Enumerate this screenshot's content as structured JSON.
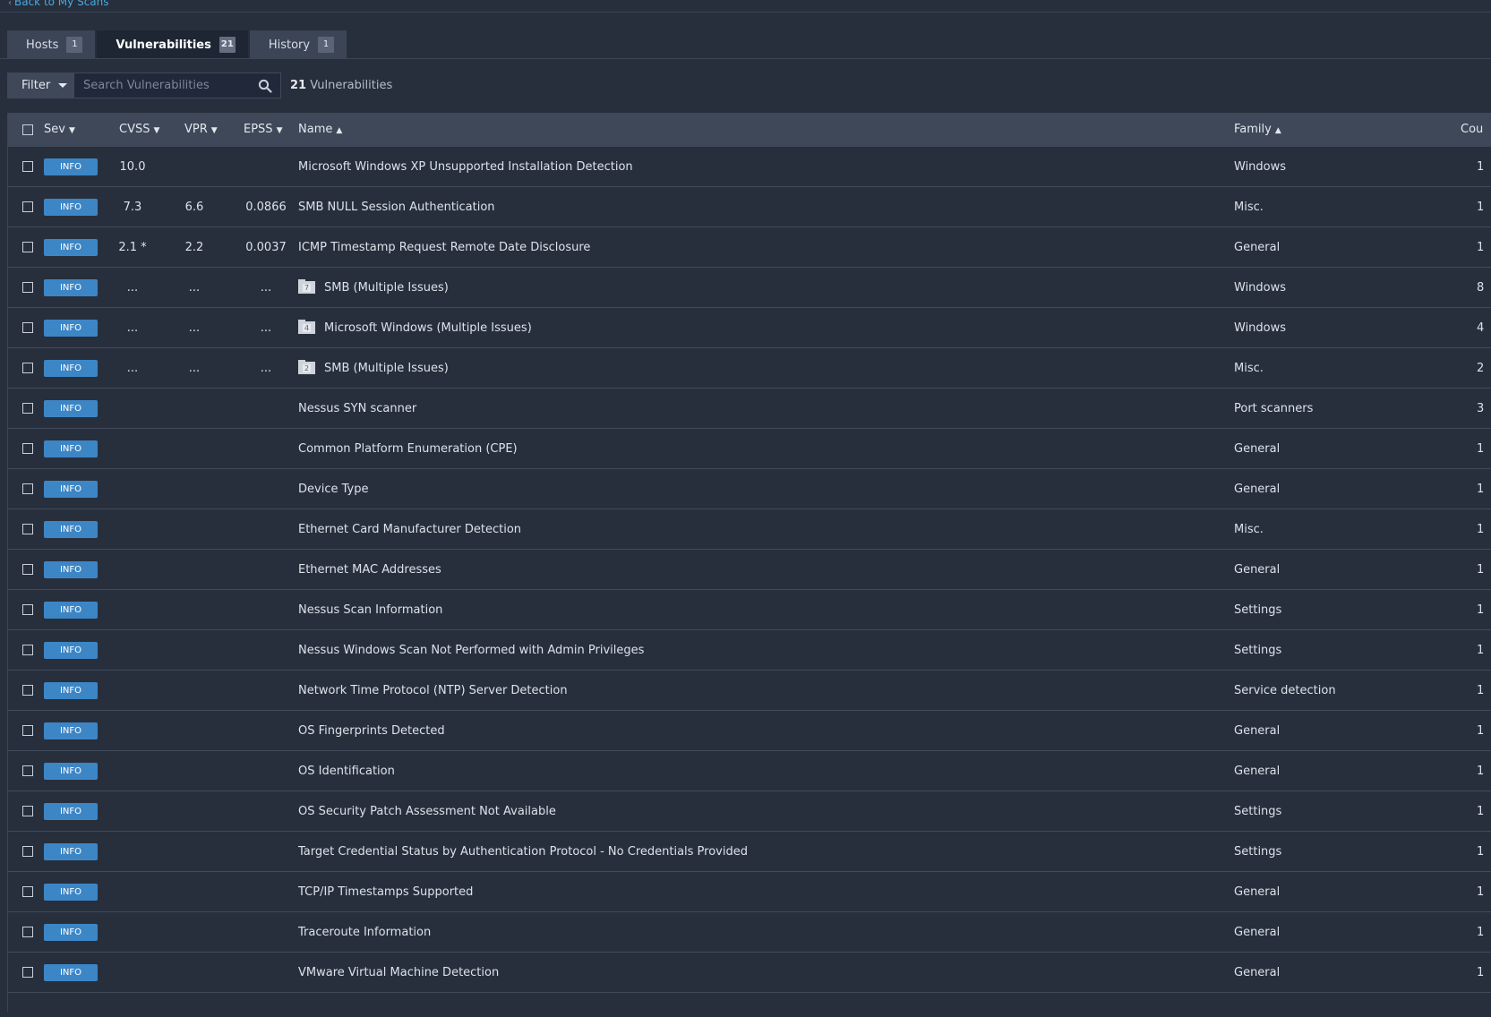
{
  "nav": {
    "back_label": "Back to My Scans"
  },
  "tabs": [
    {
      "label": "Hosts",
      "count": "1"
    },
    {
      "label": "Vulnerabilities",
      "count": "21"
    },
    {
      "label": "History",
      "count": "1"
    }
  ],
  "filter": {
    "button_label": "Filter",
    "search_placeholder": "Search Vulnerabilities",
    "search_value": "",
    "result_count": "21",
    "result_label": "Vulnerabilities"
  },
  "columns": {
    "sev": "Sev",
    "cvss": "CVSS",
    "vpr": "VPR",
    "epss": "EPSS",
    "name": "Name",
    "family": "Family",
    "count": "Cou"
  },
  "colors": {
    "severity_info": "#3d86c6",
    "link": "#4aa8de",
    "background": "#272f3d",
    "header": "#3e4858"
  },
  "rows": [
    {
      "sev": "INFO",
      "cvss": "10.0",
      "vpr": "",
      "epss": "",
      "name": "Microsoft Windows XP Unsupported Installation Detection",
      "family": "Windows",
      "count": "1",
      "group": ""
    },
    {
      "sev": "INFO",
      "cvss": "7.3",
      "vpr": "6.6",
      "epss": "0.0866",
      "name": "SMB NULL Session Authentication",
      "family": "Misc.",
      "count": "1",
      "group": ""
    },
    {
      "sev": "INFO",
      "cvss": "2.1 *",
      "vpr": "2.2",
      "epss": "0.0037",
      "name": "ICMP Timestamp Request Remote Date Disclosure",
      "family": "General",
      "count": "1",
      "group": ""
    },
    {
      "sev": "INFO",
      "cvss": "...",
      "vpr": "...",
      "epss": "...",
      "name": "SMB (Multiple Issues)",
      "family": "Windows",
      "count": "8",
      "group": "7"
    },
    {
      "sev": "INFO",
      "cvss": "...",
      "vpr": "...",
      "epss": "...",
      "name": "Microsoft Windows (Multiple Issues)",
      "family": "Windows",
      "count": "4",
      "group": "4"
    },
    {
      "sev": "INFO",
      "cvss": "...",
      "vpr": "...",
      "epss": "...",
      "name": "SMB (Multiple Issues)",
      "family": "Misc.",
      "count": "2",
      "group": "2"
    },
    {
      "sev": "INFO",
      "cvss": "",
      "vpr": "",
      "epss": "",
      "name": "Nessus SYN scanner",
      "family": "Port scanners",
      "count": "3",
      "group": ""
    },
    {
      "sev": "INFO",
      "cvss": "",
      "vpr": "",
      "epss": "",
      "name": "Common Platform Enumeration (CPE)",
      "family": "General",
      "count": "1",
      "group": ""
    },
    {
      "sev": "INFO",
      "cvss": "",
      "vpr": "",
      "epss": "",
      "name": "Device Type",
      "family": "General",
      "count": "1",
      "group": ""
    },
    {
      "sev": "INFO",
      "cvss": "",
      "vpr": "",
      "epss": "",
      "name": "Ethernet Card Manufacturer Detection",
      "family": "Misc.",
      "count": "1",
      "group": ""
    },
    {
      "sev": "INFO",
      "cvss": "",
      "vpr": "",
      "epss": "",
      "name": "Ethernet MAC Addresses",
      "family": "General",
      "count": "1",
      "group": ""
    },
    {
      "sev": "INFO",
      "cvss": "",
      "vpr": "",
      "epss": "",
      "name": "Nessus Scan Information",
      "family": "Settings",
      "count": "1",
      "group": ""
    },
    {
      "sev": "INFO",
      "cvss": "",
      "vpr": "",
      "epss": "",
      "name": "Nessus Windows Scan Not Performed with Admin Privileges",
      "family": "Settings",
      "count": "1",
      "group": ""
    },
    {
      "sev": "INFO",
      "cvss": "",
      "vpr": "",
      "epss": "",
      "name": "Network Time Protocol (NTP) Server Detection",
      "family": "Service detection",
      "count": "1",
      "group": ""
    },
    {
      "sev": "INFO",
      "cvss": "",
      "vpr": "",
      "epss": "",
      "name": "OS Fingerprints Detected",
      "family": "General",
      "count": "1",
      "group": ""
    },
    {
      "sev": "INFO",
      "cvss": "",
      "vpr": "",
      "epss": "",
      "name": "OS Identification",
      "family": "General",
      "count": "1",
      "group": ""
    },
    {
      "sev": "INFO",
      "cvss": "",
      "vpr": "",
      "epss": "",
      "name": "OS Security Patch Assessment Not Available",
      "family": "Settings",
      "count": "1",
      "group": ""
    },
    {
      "sev": "INFO",
      "cvss": "",
      "vpr": "",
      "epss": "",
      "name": "Target Credential Status by Authentication Protocol - No Credentials Provided",
      "family": "Settings",
      "count": "1",
      "group": ""
    },
    {
      "sev": "INFO",
      "cvss": "",
      "vpr": "",
      "epss": "",
      "name": "TCP/IP Timestamps Supported",
      "family": "General",
      "count": "1",
      "group": ""
    },
    {
      "sev": "INFO",
      "cvss": "",
      "vpr": "",
      "epss": "",
      "name": "Traceroute Information",
      "family": "General",
      "count": "1",
      "group": ""
    },
    {
      "sev": "INFO",
      "cvss": "",
      "vpr": "",
      "epss": "",
      "name": "VMware Virtual Machine Detection",
      "family": "General",
      "count": "1",
      "group": ""
    }
  ]
}
